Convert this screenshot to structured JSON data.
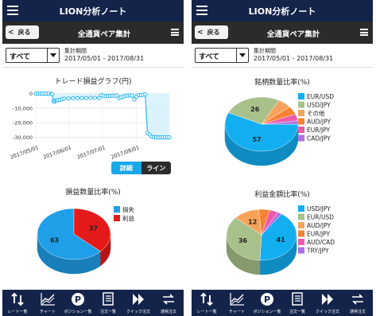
{
  "screens": [
    {
      "app_title": "LION分析ノート",
      "back_label": "戻る",
      "page_title": "全通貨ペア集計",
      "filter": "すべて",
      "period_label": "集計期間",
      "period_value": "2017/05/01 - 2017/08/31",
      "line_chart_title": "トレード損益グラフ(円)",
      "detail_label": "詳細",
      "line_label": "ライン",
      "pie_title": "損益数量比率(%)"
    },
    {
      "app_title": "LION分析ノート",
      "back_label": "戻る",
      "page_title": "全通貨ペア集計",
      "filter": "すべて",
      "period_label": "集計期間",
      "period_value": "2017/05/01 - 2017/08/31",
      "pie1_title": "銘柄数量比率(%)",
      "pie2_title": "利益金額比率(%)"
    }
  ],
  "tabs": [
    {
      "label": "レート一覧",
      "icon": "rate-list-icon"
    },
    {
      "label": "チャート",
      "icon": "chart-icon"
    },
    {
      "label": "ポジション一覧",
      "icon": "position-list-icon"
    },
    {
      "label": "注文一覧",
      "icon": "order-list-icon"
    },
    {
      "label": "クイック注文",
      "icon": "quick-order-icon"
    },
    {
      "label": "通常注文",
      "icon": "normal-order-icon"
    }
  ],
  "colors": {
    "header": "#13234a",
    "navbar": "#2b2b2b",
    "accent": "#1aa7e8",
    "line": "#29b6f6",
    "loss": "#1e9fe8",
    "profit": "#e41a1a"
  },
  "chart_data": [
    {
      "type": "area",
      "title": "トレード損益グラフ(円)",
      "x_tick_labels": [
        "2017/05/01",
        "2017/06/01",
        "2017/07/01",
        "2017/08/01"
      ],
      "y_tick_labels": [
        "0",
        "-10,000",
        "-20,000",
        "-30,000"
      ],
      "ylim": [
        -33000,
        2000
      ],
      "x": [
        0,
        2,
        4,
        6,
        8,
        10,
        12,
        14,
        15,
        16,
        17,
        18,
        19,
        20,
        22,
        24,
        26,
        30,
        34,
        38,
        42,
        46,
        50,
        54,
        58,
        60,
        62,
        64,
        66,
        68,
        70,
        72,
        74,
        76,
        78,
        80,
        82,
        84,
        86,
        88,
        90,
        92,
        94,
        96,
        98,
        100,
        102,
        104,
        106,
        108,
        110,
        112,
        114,
        116,
        118,
        120,
        122
      ],
      "values": [
        0,
        0,
        0,
        0,
        0,
        0,
        0,
        -100,
        -300,
        -5000,
        -5600,
        -4800,
        -4500,
        -4500,
        -4300,
        -3800,
        -3400,
        -3300,
        -3100,
        -3100,
        -3000,
        -3000,
        -2900,
        -2900,
        -3000,
        -1000,
        -1500,
        -1800,
        -1600,
        -1600,
        -1400,
        -1400,
        -1300,
        -3000,
        -2500,
        -2200,
        -1400,
        -1400,
        -1200,
        -1200,
        -4000,
        -2000,
        -1100,
        -1000,
        -800,
        -500,
        -27000,
        -28000,
        -29500,
        -29800,
        -30000,
        -30000,
        -30000,
        -30000,
        -30000,
        -30000,
        -30000
      ],
      "grid": true
    },
    {
      "type": "pie",
      "title": "損益数量比率(%)",
      "categories": [
        "損失",
        "利益"
      ],
      "values": [
        63,
        37
      ],
      "colors": [
        "#1e9fe8",
        "#e41a1a"
      ],
      "legend": "right"
    },
    {
      "type": "pie",
      "title": "銘柄数量比率(%)",
      "categories": [
        "EUR/USD",
        "USD/JPY",
        "その他",
        "AUD/JPY",
        "EUR/JPY",
        "CAD/JPY"
      ],
      "values": [
        57,
        26,
        6,
        5,
        4,
        2
      ],
      "data_labels": [
        "57",
        "26",
        "",
        "",
        "",
        ""
      ],
      "colors": [
        "#12aef0",
        "#a8c08a",
        "#f7a35c",
        "#f58231",
        "#ec5aa8",
        "#b06ee6"
      ],
      "legend": "right"
    },
    {
      "type": "pie",
      "title": "利益金額比率(%)",
      "categories": [
        "USD/JPY",
        "EUR/USD",
        "AUD/JPY",
        "EUR/JPY",
        "AUD/CAD",
        "TRY/JPY"
      ],
      "values": [
        41,
        36,
        12,
        5,
        4,
        2
      ],
      "data_labels": [
        "41",
        "36",
        "12",
        "",
        "",
        ""
      ],
      "colors": [
        "#12aef0",
        "#a8c08a",
        "#f7a35c",
        "#f58231",
        "#ec5aa8",
        "#b06ee6"
      ],
      "legend": "right"
    }
  ]
}
